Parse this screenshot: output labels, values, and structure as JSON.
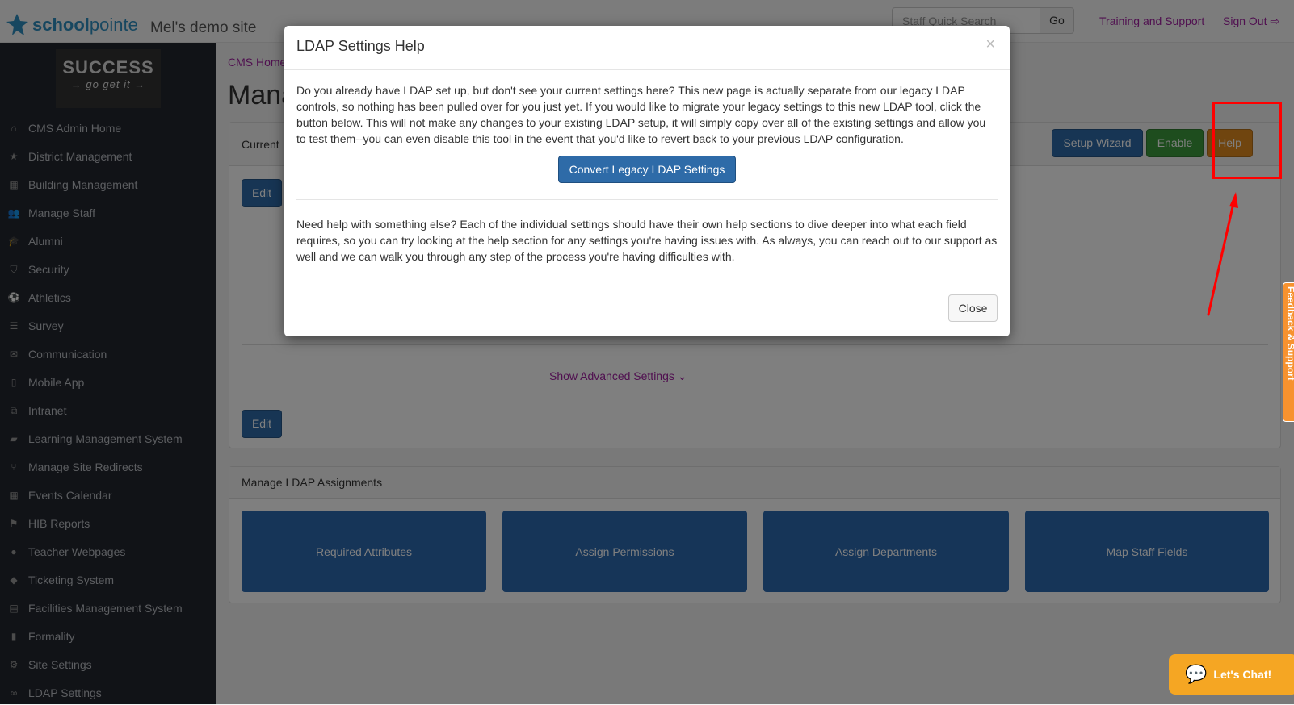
{
  "header": {
    "brand_bold": "school",
    "brand_light": "pointe",
    "site_name": "Mel's demo site",
    "search_placeholder": "Staff Quick Search",
    "go_label": "Go",
    "training_link": "Training and Support",
    "signout_link": "Sign Out"
  },
  "sidebar": {
    "logo_text": "SUCCESS",
    "logo_sub": "→ go get it →",
    "items": [
      {
        "label": "CMS Admin Home",
        "icon": "home-icon",
        "glyph": "⌂"
      },
      {
        "label": "District Management",
        "icon": "star-icon",
        "glyph": "★"
      },
      {
        "label": "Building Management",
        "icon": "building-icon",
        "glyph": "▦"
      },
      {
        "label": "Manage Staff",
        "icon": "users-icon",
        "glyph": "👥"
      },
      {
        "label": "Alumni",
        "icon": "graduation-cap-icon",
        "glyph": "🎓"
      },
      {
        "label": "Security",
        "icon": "shield-icon",
        "glyph": "⛉"
      },
      {
        "label": "Athletics",
        "icon": "soccer-ball-icon",
        "glyph": "⚽"
      },
      {
        "label": "Survey",
        "icon": "list-icon",
        "glyph": "☰"
      },
      {
        "label": "Communication",
        "icon": "envelope-icon",
        "glyph": "✉"
      },
      {
        "label": "Mobile App",
        "icon": "mobile-icon",
        "glyph": "▯"
      },
      {
        "label": "Intranet",
        "icon": "sitemap-icon",
        "glyph": "⧉"
      },
      {
        "label": "Learning Management System",
        "icon": "book-icon",
        "glyph": "▰"
      },
      {
        "label": "Manage Site Redirects",
        "icon": "fork-icon",
        "glyph": "⑂"
      },
      {
        "label": "Events Calendar",
        "icon": "calendar-icon",
        "glyph": "▦"
      },
      {
        "label": "HIB Reports",
        "icon": "flag-icon",
        "glyph": "⚑"
      },
      {
        "label": "Teacher Webpages",
        "icon": "user-icon",
        "glyph": "●"
      },
      {
        "label": "Ticketing System",
        "icon": "ticket-icon",
        "glyph": "◆"
      },
      {
        "label": "Facilities Management System",
        "icon": "clipboard-icon",
        "glyph": "▤"
      },
      {
        "label": "Formality",
        "icon": "file-icon",
        "glyph": "▮"
      },
      {
        "label": "Site Settings",
        "icon": "gears-icon",
        "glyph": "⚙"
      },
      {
        "label": "LDAP Settings",
        "icon": "handshake-icon",
        "glyph": "∞"
      }
    ]
  },
  "main": {
    "breadcrumb": "CMS Home",
    "title": "Manage LDAP Settings",
    "panel1": {
      "header": "Current",
      "setup_wizard": "Setup Wizard",
      "enable": "Enable",
      "help": "Help",
      "edit": "Edit",
      "show_advanced": "Show Advanced Settings"
    },
    "panel2": {
      "header": "Manage LDAP Assignments",
      "tiles": [
        "Required Attributes",
        "Assign Permissions",
        "Assign Departments",
        "Map Staff Fields"
      ]
    }
  },
  "modal": {
    "title": "LDAP Settings Help",
    "close_x": "×",
    "para1": "Do you already have LDAP set up, but don't see your current settings here? This new page is actually separate from our legacy LDAP controls, so nothing has been pulled over for you just yet. If you would like to migrate your legacy settings to this new LDAP tool, click the button below. This will not make any changes to your existing LDAP setup, it will simply copy over all of the existing settings and allow you to test them--you can even disable this tool in the event that you'd like to revert back to your previous LDAP configuration.",
    "convert_button": "Convert Legacy LDAP Settings",
    "para2": "Need help with something else? Each of the individual settings should have their own help sections to dive deeper into what each field requires, so you can try looking at the help section for any settings you're having issues with. As always, you can reach out to our support as well and we can walk you through any step of the process you're having difficulties with.",
    "close_button": "Close"
  },
  "feedback_tab": "Feedback & Support",
  "chat_label": "Let's Chat!",
  "colors": {
    "accent_link": "#a020a0",
    "primary": "#2e6ba8",
    "success": "#3c9a3c",
    "warning": "#e08a1e",
    "annotation": "#ff0000",
    "chat": "#f5a623"
  }
}
